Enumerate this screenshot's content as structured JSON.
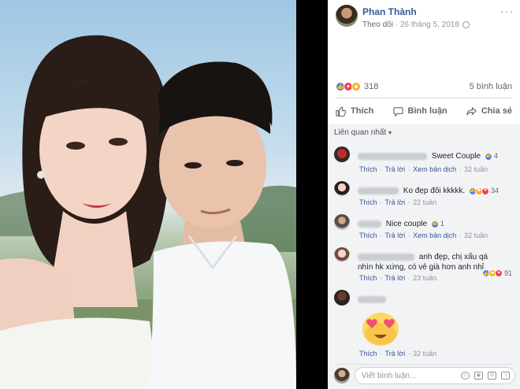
{
  "post": {
    "author_name": "Phan Thành",
    "follow_label": "Theo dõi",
    "date": "26 tháng 5, 2018",
    "reaction_count": "318",
    "comment_count": "5 bình luận"
  },
  "actions": {
    "like": "Thích",
    "comment": "Bình luận",
    "share": "Chia sẻ"
  },
  "sort_label": "Liên quan nhất",
  "link_labels": {
    "like": "Thích",
    "reply": "Trả lời",
    "translate": "Xem bản dịch"
  },
  "comments": [
    {
      "text": "Sweet Couple",
      "reactions": "4",
      "time": "32 tuần"
    },
    {
      "text": "Ko đẹp đôi kkkkk.",
      "reactions": "34",
      "time": "22 tuần"
    },
    {
      "text": "Nice couple",
      "reactions": "1",
      "time": "32 tuần"
    },
    {
      "text_line1": "anh đẹp, chị xấu qá",
      "text_line2": "nhìn hk xứng, có vẻ già hơn anh nhỉ",
      "reactions": "91",
      "time": "23 tuần"
    },
    {
      "time": "32 tuần"
    }
  ],
  "composer": {
    "placeholder": "Viết bình luận..."
  },
  "colors": {
    "link": "#365899",
    "like_blue": "#4080ff",
    "love_red": "#f33e58",
    "haha_yellow": "#f7b125"
  }
}
